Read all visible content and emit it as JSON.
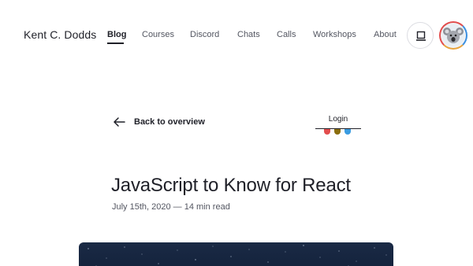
{
  "header": {
    "site_title": "Kent C. Dodds",
    "nav": [
      {
        "label": "Blog",
        "active": true
      },
      {
        "label": "Courses",
        "active": false
      },
      {
        "label": "Discord",
        "active": false
      },
      {
        "label": "Chats",
        "active": false
      },
      {
        "label": "Calls",
        "active": false
      },
      {
        "label": "Workshops",
        "active": false
      },
      {
        "label": "About",
        "active": false
      }
    ],
    "theme_toggle_icon": "laptop-icon",
    "avatar_icon": "koala-avatar"
  },
  "back": {
    "label": "Back to overview",
    "icon": "arrow-left-icon"
  },
  "login": {
    "label": "Login",
    "team_colors": [
      "#e24d4d",
      "#8a6d0e",
      "#3a9be0"
    ]
  },
  "article": {
    "title": "JavaScript to Know for React",
    "meta": "July 15th, 2020 — 14 min read"
  },
  "hero": {
    "image": "starry-night-sky"
  }
}
